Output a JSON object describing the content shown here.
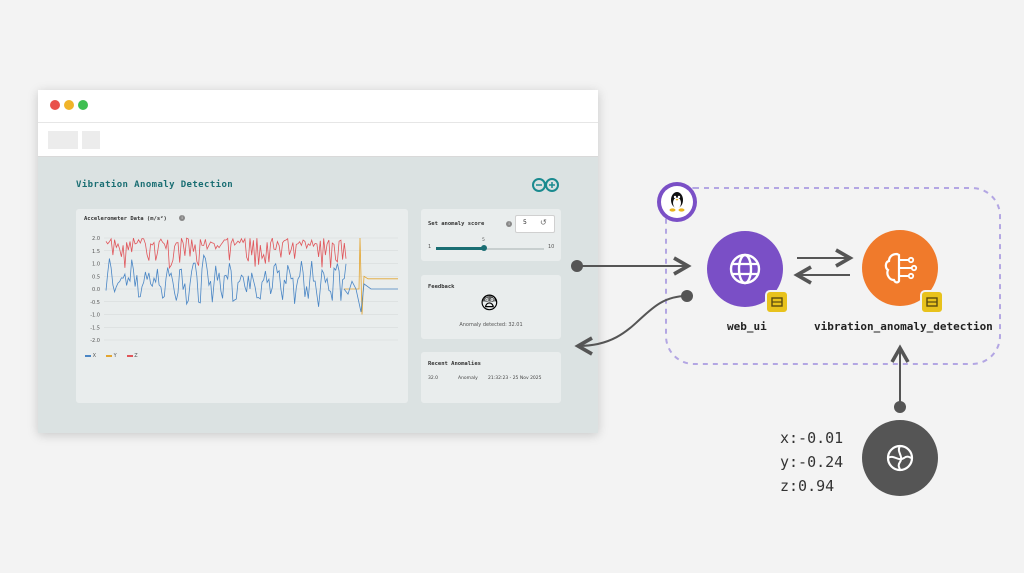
{
  "browser": {
    "app_title": "Vibration Anomaly Detection",
    "chart_card": {
      "title": "Accelerometer Data (m/s²)",
      "info_icon": "info-icon",
      "legend": [
        "X",
        "Y",
        "Z"
      ]
    },
    "score_card": {
      "title": "Set anomaly score",
      "value": "5",
      "slider_min": "1",
      "slider_max": "10",
      "slider_value_label": "5",
      "slider_fraction": 0.44
    },
    "feedback_card": {
      "title": "Feedback",
      "emoji": "😨",
      "message": "Anomaly detected: 32.01"
    },
    "anomalies_card": {
      "title": "Recent Anomalies",
      "rows": [
        {
          "score": "32.0",
          "label": "Anomaly",
          "time": "21:32:23 - 25 Nov 2025"
        }
      ]
    }
  },
  "chart_data": {
    "type": "line",
    "title": "Accelerometer Data (m/s²)",
    "yticks": [
      "2.0",
      "1.5",
      "1.0",
      "0.5",
      "0.0",
      "-0.5",
      "-1.0",
      "-1.5",
      "-2.0"
    ],
    "ylim": [
      -2.0,
      2.0
    ],
    "series": [
      {
        "name": "X",
        "color": "#4a86c5"
      },
      {
        "name": "Y",
        "color": "#e3a530"
      },
      {
        "name": "Z",
        "color": "#e0555a"
      }
    ]
  },
  "diagram": {
    "linux_icon": "linux-tux-icon",
    "web_ui": {
      "label": "web_ui",
      "color": "#7a4fc6",
      "icon": "globe-icon"
    },
    "detector": {
      "label": "vibration_anomaly_detection",
      "color": "#f07a2b",
      "icon": "brain-circuit-icon"
    },
    "sensor": {
      "icon": "sensor-icon",
      "color": "#555555"
    },
    "readings": [
      "x:-0.01",
      "y:-0.24",
      "z:0.94"
    ]
  }
}
